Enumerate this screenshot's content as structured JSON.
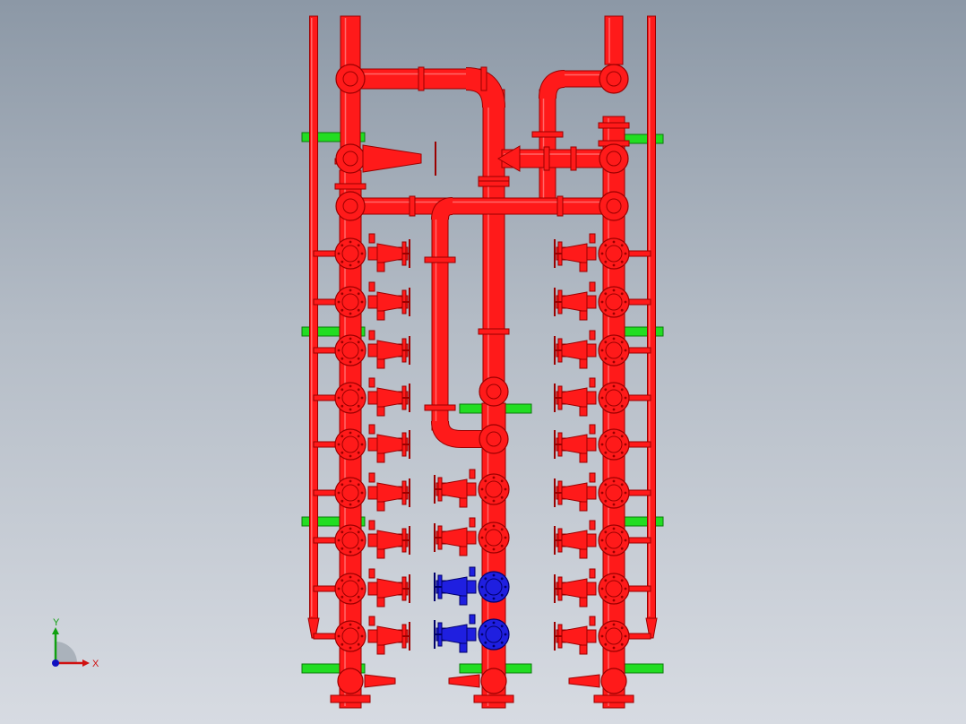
{
  "viewport": {
    "background_top": "#8c98a6",
    "background_bottom": "#d7dbe2"
  },
  "model": {
    "pipe_color": "#ff1a1a",
    "pipe_dark": "#9a0000",
    "highlight_color": "#1f1fe0",
    "highlight_dark": "#00006a",
    "support_color": "#22dd22",
    "left_header_valve_count": 9,
    "right_header_valve_count": 9,
    "center_header_valve_count": 4,
    "center_highlighted_valve_count": 2
  },
  "triad": {
    "x_label": "X",
    "y_label": "Y",
    "x_color": "#d01010",
    "y_color": "#10a010",
    "z_color": "#1010c0"
  }
}
